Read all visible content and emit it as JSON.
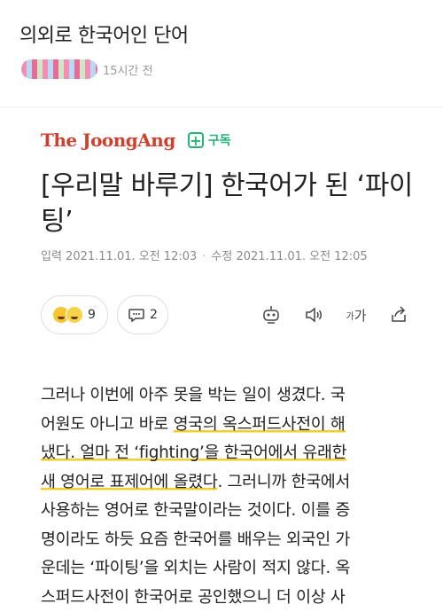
{
  "post": {
    "title": "의외로 한국어인 단어",
    "time": "15시간 전"
  },
  "article": {
    "brand": "The JoongAng",
    "subscribe_label": "구독",
    "headline": "[우리말 바루기] 한국어가 된 ‘파이팅’",
    "input_date": "입력 2021.11.01. 오전 12:03",
    "modified_date": "수정 2021.11.01. 오전 12:05",
    "reactions_count": "9",
    "comments_count": "2",
    "font_size_label_small": "가",
    "font_size_label_large": "가",
    "body_lines": [
      {
        "pre": "그러나 이번에 아주 못을 박는 일이 생겼다. 국",
        "hl": "",
        "post": ""
      },
      {
        "pre": "어원도 아니고 바로 ",
        "hl": "영국의 옥스퍼드사전이 해",
        "post": ""
      },
      {
        "pre": "",
        "hl": "냈다. 얼마 전 ‘fighting’을 한국어에서 유래한",
        "post": ""
      },
      {
        "pre": "",
        "hl": "새 영어로 표제어에 올렸다",
        "post": ". 그러니까 한국에서"
      },
      {
        "pre": "사용하는 영어로 한국말이라는 것이다. 이를 증",
        "hl": "",
        "post": ""
      },
      {
        "pre": "명이라도 하듯 요즘 한국어를 배우는 외국인 가",
        "hl": "",
        "post": ""
      },
      {
        "pre": "운데는 ‘파이팅’을 외치는 사람이 적지 않다. 옥",
        "hl": "",
        "post": ""
      },
      {
        "pre": "스퍼드사전이 한국어로 공인했으니 더 이상 사",
        "hl": "",
        "post": ""
      }
    ]
  },
  "colors": {
    "brand": "#d0402f",
    "subscribe": "#22b573",
    "highlight": "#f3cf2d"
  }
}
